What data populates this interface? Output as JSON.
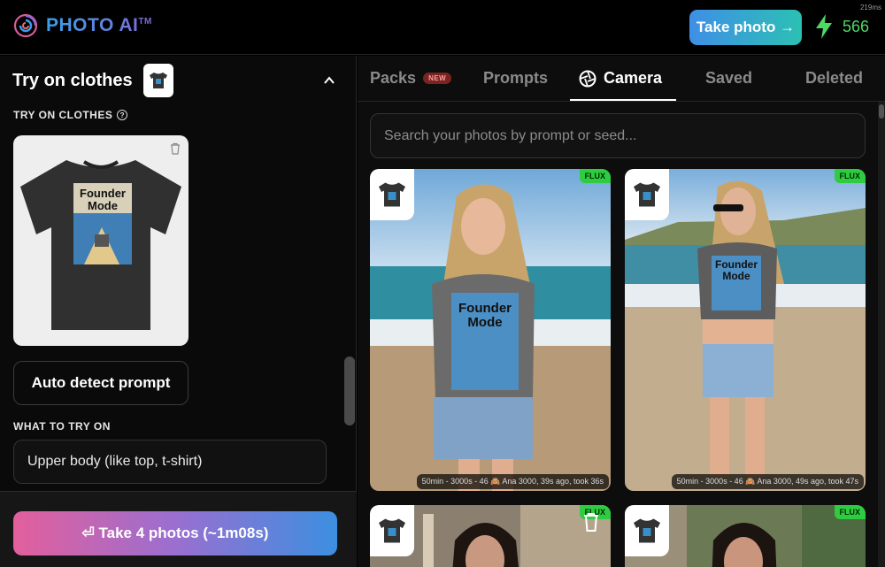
{
  "header": {
    "logo_text": "PHOTO AI",
    "logo_tm": "TM",
    "take_photo_label": "Take photo →",
    "credits": "566",
    "corner_label": "219ms"
  },
  "left_panel": {
    "section_title": "Try on clothes",
    "try_on_label": "TRY ON CLOTHES",
    "shirt_text_line1": "Founder",
    "shirt_text_line2": "Mode",
    "auto_detect_label": "Auto detect prompt",
    "what_to_try_label": "WHAT TO TRY ON",
    "what_to_try_value": "Upper body (like top, t-shirt)",
    "take_photos_label": "⏎ Take 4 photos (~1m08s)"
  },
  "right_panel": {
    "tabs": [
      {
        "label": "Packs",
        "badge": "NEW"
      },
      {
        "label": "Prompts"
      },
      {
        "label": "Camera"
      },
      {
        "label": "Saved"
      },
      {
        "label": "Deleted"
      }
    ],
    "active_tab": "Camera",
    "search_placeholder": "Search your photos by prompt or seed...",
    "cards": [
      {
        "badge": "FLUX",
        "caption": "50min - 3000s - 46 🙈 Ana 3000, 39s ago, took 36s"
      },
      {
        "badge": "FLUX",
        "caption": "50min - 3000s - 46 🙈 Ana 3000, 49s ago, took 47s"
      },
      {
        "badge": "FLUX"
      },
      {
        "badge": "FLUX"
      }
    ]
  },
  "colors": {
    "accent_green": "#2ecc40",
    "credits_green": "#4cd964",
    "take_photo_gradient_start": "#3f8fe6",
    "take_photo_gradient_end": "#2cc0b4"
  }
}
